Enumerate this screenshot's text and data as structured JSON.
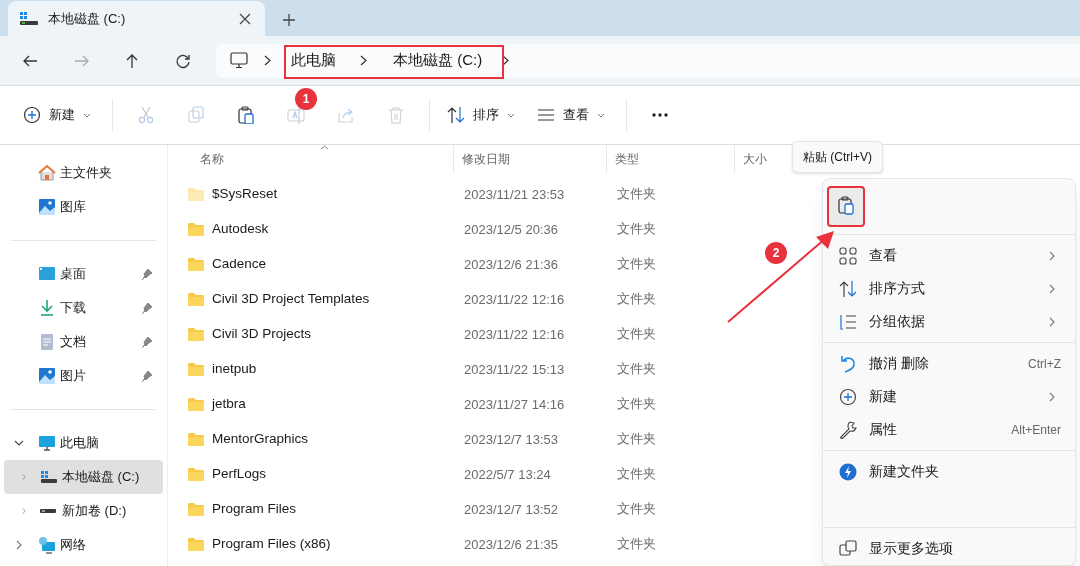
{
  "tab": {
    "title": "本地磁盘 (C:)"
  },
  "breadcrumb": [
    "此电脑",
    "本地磁盘 (C:)"
  ],
  "toolbar": [
    [
      {
        "kind": "new",
        "label": "新建",
        "disabled": false,
        "dropdown": true
      }
    ],
    [
      {
        "kind": "cut",
        "disabled": true
      },
      {
        "kind": "copy",
        "disabled": true
      },
      {
        "kind": "paste",
        "disabled": false
      },
      {
        "kind": "rename",
        "disabled": true
      },
      {
        "kind": "share",
        "disabled": true
      },
      {
        "kind": "delete",
        "disabled": true
      }
    ],
    [
      {
        "kind": "sort",
        "label": "排序",
        "disabled": false,
        "dropdown": true
      },
      {
        "kind": "view",
        "label": "查看",
        "disabled": false,
        "dropdown": true
      }
    ],
    [
      {
        "kind": "more",
        "disabled": false
      }
    ]
  ],
  "sidebar": [
    [
      {
        "kind": "home",
        "label": "主文件夹",
        "pinned": false,
        "selected": false
      },
      {
        "kind": "gallery",
        "label": "图库",
        "pinned": false,
        "selected": false
      }
    ],
    [
      {
        "kind": "desktop",
        "label": "桌面",
        "pinned": true,
        "selected": false
      },
      {
        "kind": "download",
        "label": "下载",
        "pinned": true,
        "selected": false
      },
      {
        "kind": "document",
        "label": "文档",
        "pinned": true,
        "selected": false
      },
      {
        "kind": "gallery",
        "label": "图片",
        "pinned": true,
        "selected": false
      }
    ],
    [
      {
        "kind": "pc",
        "label": "此电脑",
        "expanded": true,
        "selected": false,
        "children": [
          {
            "kind": "drive-c",
            "label": "本地磁盘 (C:)",
            "expanded": false,
            "selected": true
          },
          {
            "kind": "drive",
            "label": "新加卷 (D:)",
            "expanded": false,
            "selected": false
          }
        ]
      },
      {
        "kind": "network",
        "label": "网络",
        "expanded": false,
        "selected": false
      }
    ]
  ],
  "file_list": {
    "columns": [
      {
        "label": "名称",
        "sorted": true
      },
      {
        "label": "修改日期",
        "sorted": false
      },
      {
        "label": "类型",
        "sorted": false
      },
      {
        "label": "大小",
        "sorted": false
      }
    ],
    "rows": [
      {
        "name": "$SysReset",
        "modified": "2023/11/21 23:53",
        "type": "文件夹",
        "hidden": true
      },
      {
        "name": "Autodesk",
        "modified": "2023/12/5 20:36",
        "type": "文件夹",
        "hidden": false
      },
      {
        "name": "Cadence",
        "modified": "2023/12/6 21:36",
        "type": "文件夹",
        "hidden": false
      },
      {
        "name": "Civil 3D Project Templates",
        "modified": "2023/11/22 12:16",
        "type": "文件夹",
        "hidden": false
      },
      {
        "name": "Civil 3D Projects",
        "modified": "2023/11/22 12:16",
        "type": "文件夹",
        "hidden": false
      },
      {
        "name": "inetpub",
        "modified": "2023/11/22 15:13",
        "type": "文件夹",
        "hidden": false
      },
      {
        "name": "jetbra",
        "modified": "2023/11/27 14:16",
        "type": "文件夹",
        "hidden": false
      },
      {
        "name": "MentorGraphics",
        "modified": "2023/12/7 13:53",
        "type": "文件夹",
        "hidden": false
      },
      {
        "name": "PerfLogs",
        "modified": "2022/5/7 13:24",
        "type": "文件夹",
        "hidden": false
      },
      {
        "name": "Program Files",
        "modified": "2023/12/7 13:52",
        "type": "文件夹",
        "hidden": false
      },
      {
        "name": "Program Files (x86)",
        "modified": "2023/12/6 21:35",
        "type": "文件夹",
        "hidden": false
      }
    ]
  },
  "tooltip": "粘贴 (Ctrl+V)",
  "context_menu": [
    [
      {
        "kind": "paste",
        "highlighted": true
      }
    ],
    [
      {
        "kind": "view",
        "label": "查看",
        "submenu": true
      },
      {
        "kind": "sort",
        "label": "排序方式",
        "submenu": true
      },
      {
        "kind": "group",
        "label": "分组依据",
        "submenu": true
      }
    ],
    [
      {
        "kind": "undo",
        "label": "撤消 删除",
        "shortcut": "Ctrl+Z"
      },
      {
        "kind": "new",
        "label": "新建",
        "submenu": true
      },
      {
        "kind": "properties",
        "label": "属性",
        "shortcut": "Alt+Enter"
      }
    ],
    [
      {
        "kind": "app",
        "label": "新建文件夹"
      }
    ],
    [
      {
        "kind": "more",
        "label": "显示更多选项"
      }
    ]
  ],
  "annotations": [
    {
      "label": "1"
    },
    {
      "label": "2"
    }
  ]
}
